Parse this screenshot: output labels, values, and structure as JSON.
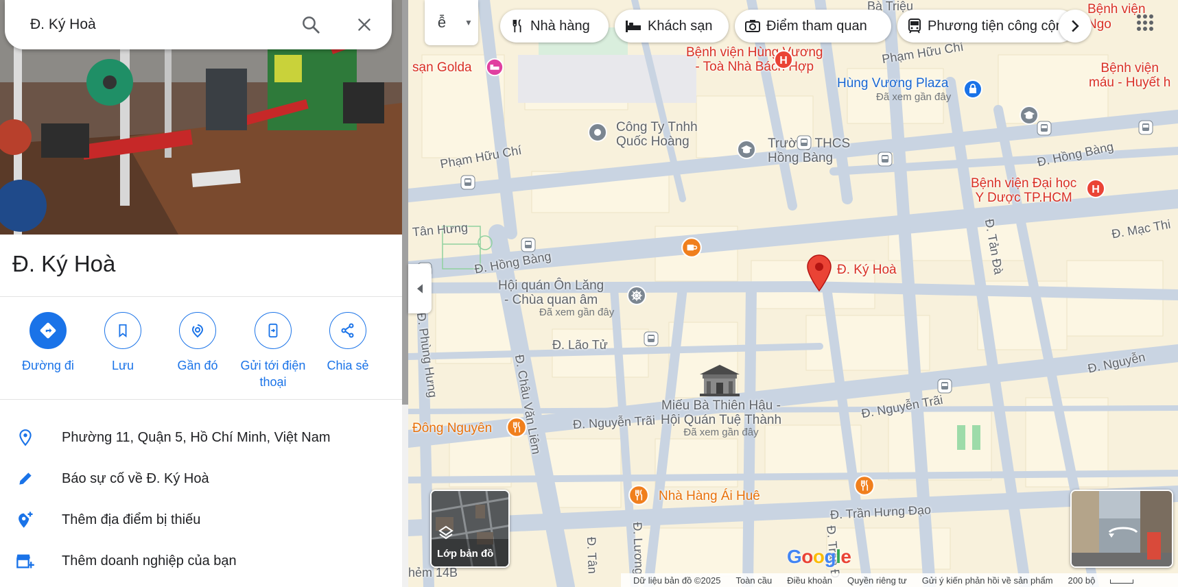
{
  "search": {
    "value": "Đ. Ký Hoà",
    "search_icon": "search-icon",
    "close_icon": "close-icon"
  },
  "place": {
    "title": "Đ. Ký Hoà"
  },
  "actions": [
    {
      "label": "Đường đi",
      "icon": "directions-icon"
    },
    {
      "label": "Lưu",
      "icon": "bookmark-icon"
    },
    {
      "label": "Gần đó",
      "icon": "nearby-icon"
    },
    {
      "label": "Gửi tới điện thoại",
      "icon": "send-to-phone-icon"
    },
    {
      "label": "Chia sẻ",
      "icon": "share-icon"
    }
  ],
  "info_rows": [
    {
      "text": "Phường 11, Quận 5, Hồ Chí Minh, Việt Nam",
      "icon": "location-pin-icon"
    },
    {
      "text": "Báo sự cố về Đ. Ký Hoà",
      "icon": "pencil-icon"
    },
    {
      "text": "Thêm địa điểm bị thiếu",
      "icon": "add-location-icon"
    },
    {
      "text": "Thêm doanh nghiệp của bạn",
      "icon": "add-business-icon"
    }
  ],
  "chips": [
    {
      "label": "Nhà hàng",
      "icon": "restaurant-icon"
    },
    {
      "label": "Khách sạn",
      "icon": "hotel-icon"
    },
    {
      "label": "Điểm tham quan",
      "icon": "camera-icon"
    },
    {
      "label": "Phương tiện công cộng",
      "icon": "transit-icon"
    }
  ],
  "map": {
    "roads": {
      "pham_huu_chi_w": "Phạm Hữu Chí",
      "pham_huu_chi_e": "Phạm Hữu Chí",
      "hong_bang_w": "Đ. Hồng Bàng",
      "hong_bang_e": "Đ. Hồng Bàng",
      "tan_hung": "Tân Hưng",
      "phung_hung": "Đ. Phùng Hưng",
      "chau_van_liem": "Đ. Châu Văn Liêm",
      "lao_tu": "Đ. Lão Tử",
      "nguyen_trai_w": "Đ. Nguyễn Trãi",
      "nguyen_trai_m": "Đ. Nguyễn Trãi",
      "nguyen_trai_e": "Đ. Nguyễn",
      "tran_hung_dao": "Đ. Trần Hưng Đạo",
      "tan_da": "Đ. Tản Đà",
      "mac_thien": "Đ. Mạc Thi",
      "ba_trieu": "Bà Triệu",
      "luong": "Đ. Lương",
      "tan": "Đ. Tân",
      "tran_d": "Đ. Trần Đ",
      "hem": "hẻm 14B"
    },
    "pois": {
      "hung_vuong_hospital": "Bệnh viện Hùng Vương\n- Toà Nhà Bách Hợp",
      "hung_vuong_plaza": "Hùng Vương Plaza",
      "seen_recently": "Đã xem gần đây",
      "cong_ty": "Công Ty Tnhh\nQuốc Hoàng",
      "truong_thcs": "Trường THCS\nHồng Bàng",
      "bv_dai_hoc": "Bệnh viện Đại học\nY Dược TP.HCM",
      "hoi_quan": "Hội quán Ôn Lăng\n- Chùa quan âm",
      "ky_hoa_pin": "Đ. Ký Hoà",
      "mieu_ba": "Miếu Bà Thiên Hậu -\nHội Quán Tuệ Thành",
      "dong_nguyen": "Đông Nguyên",
      "nha_hang_ai_hue": "Nhà Hàng Ái Huê",
      "san_golda": "sạn Golda",
      "bv_right": "Bệnh viện",
      "bv_mau": "Bệnh viện\nmáu - Huyết h",
      "ngo": "Ngo"
    },
    "layers_label": "Lớp bản đồ",
    "google": "Google",
    "footer": {
      "data": "Dữ liệu bản đồ ©2025",
      "global": "Toàn cầu",
      "terms": "Điều khoản",
      "privacy": "Quyền riêng tư",
      "feedback": "Gửi ý kiến phản hồi về sản phẩm",
      "scale": "200 bộ"
    }
  },
  "colors": {
    "accent": "#1a73e8",
    "pin": "#ea4335",
    "poi_orange": "#f07f1d",
    "road": "#c8d3e0"
  }
}
